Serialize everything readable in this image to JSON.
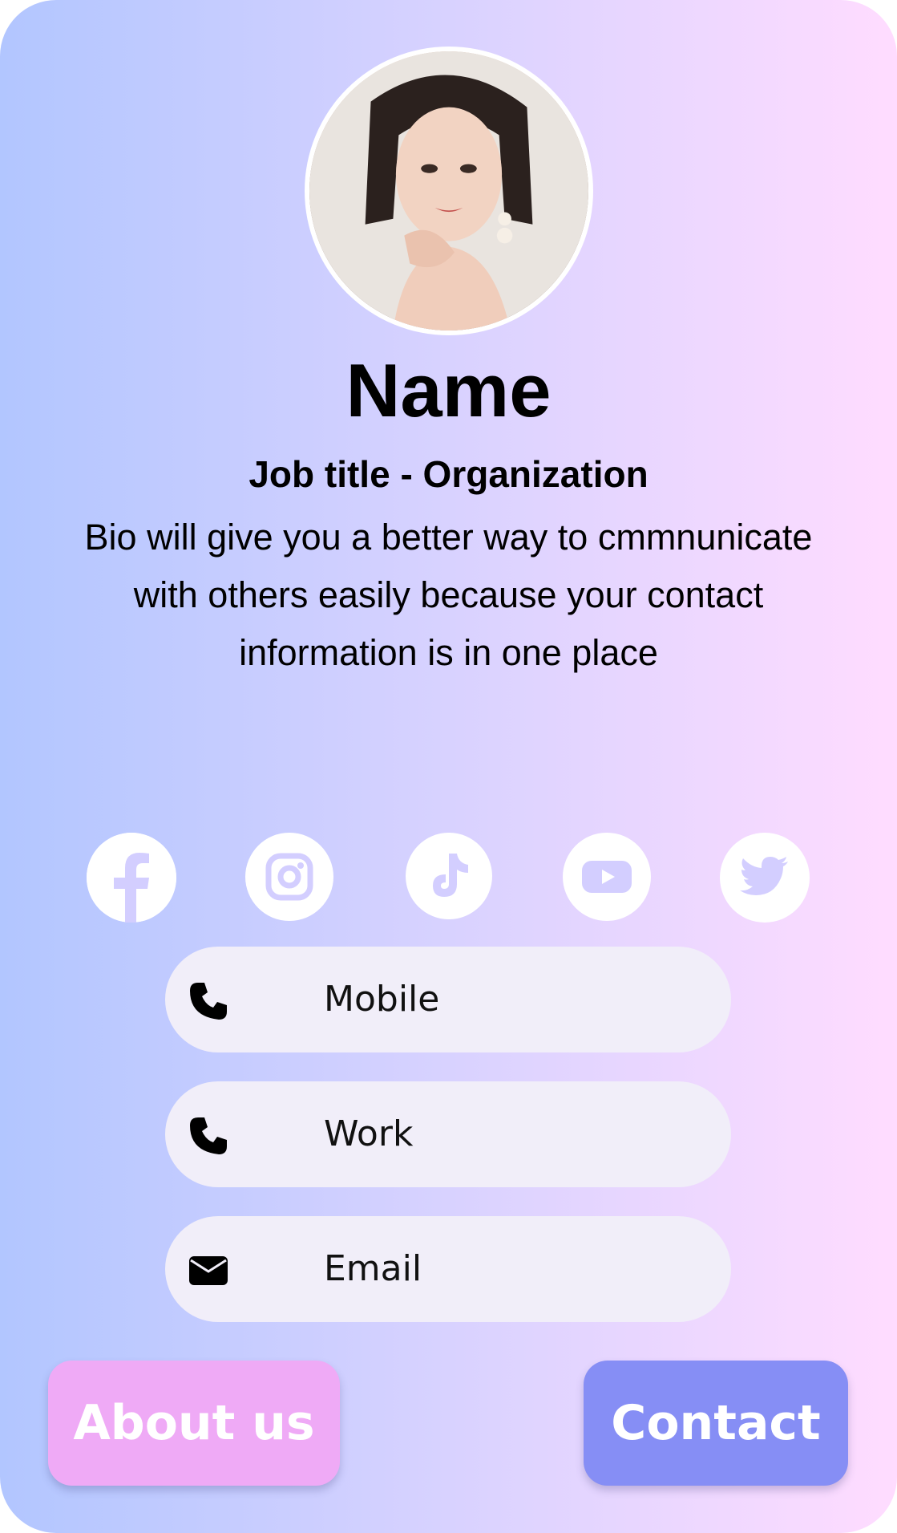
{
  "profile": {
    "name": "Name",
    "job_title": "Job title - Organization",
    "bio": "Bio will give you a better way to cmmnunicate with others easily because your contact information is in one place"
  },
  "socials": [
    {
      "icon": "facebook-icon"
    },
    {
      "icon": "instagram-icon"
    },
    {
      "icon": "tiktok-icon"
    },
    {
      "icon": "youtube-icon"
    },
    {
      "icon": "twitter-icon"
    }
  ],
  "contacts": {
    "mobile_label": "Mobile",
    "work_label": "Work",
    "email_label": "Email"
  },
  "buttons": {
    "about_label": "About us",
    "contact_label": "Contact"
  },
  "colors": {
    "gradient_left": "#b2c6ff",
    "gradient_mid": "#d8d2ff",
    "gradient_right": "#ffdcff",
    "pill_bg": "#f1eef9",
    "about_button": "#efaaf6",
    "contact_button": "#868ef5",
    "social_icon_glyph": "#d3ceff"
  }
}
